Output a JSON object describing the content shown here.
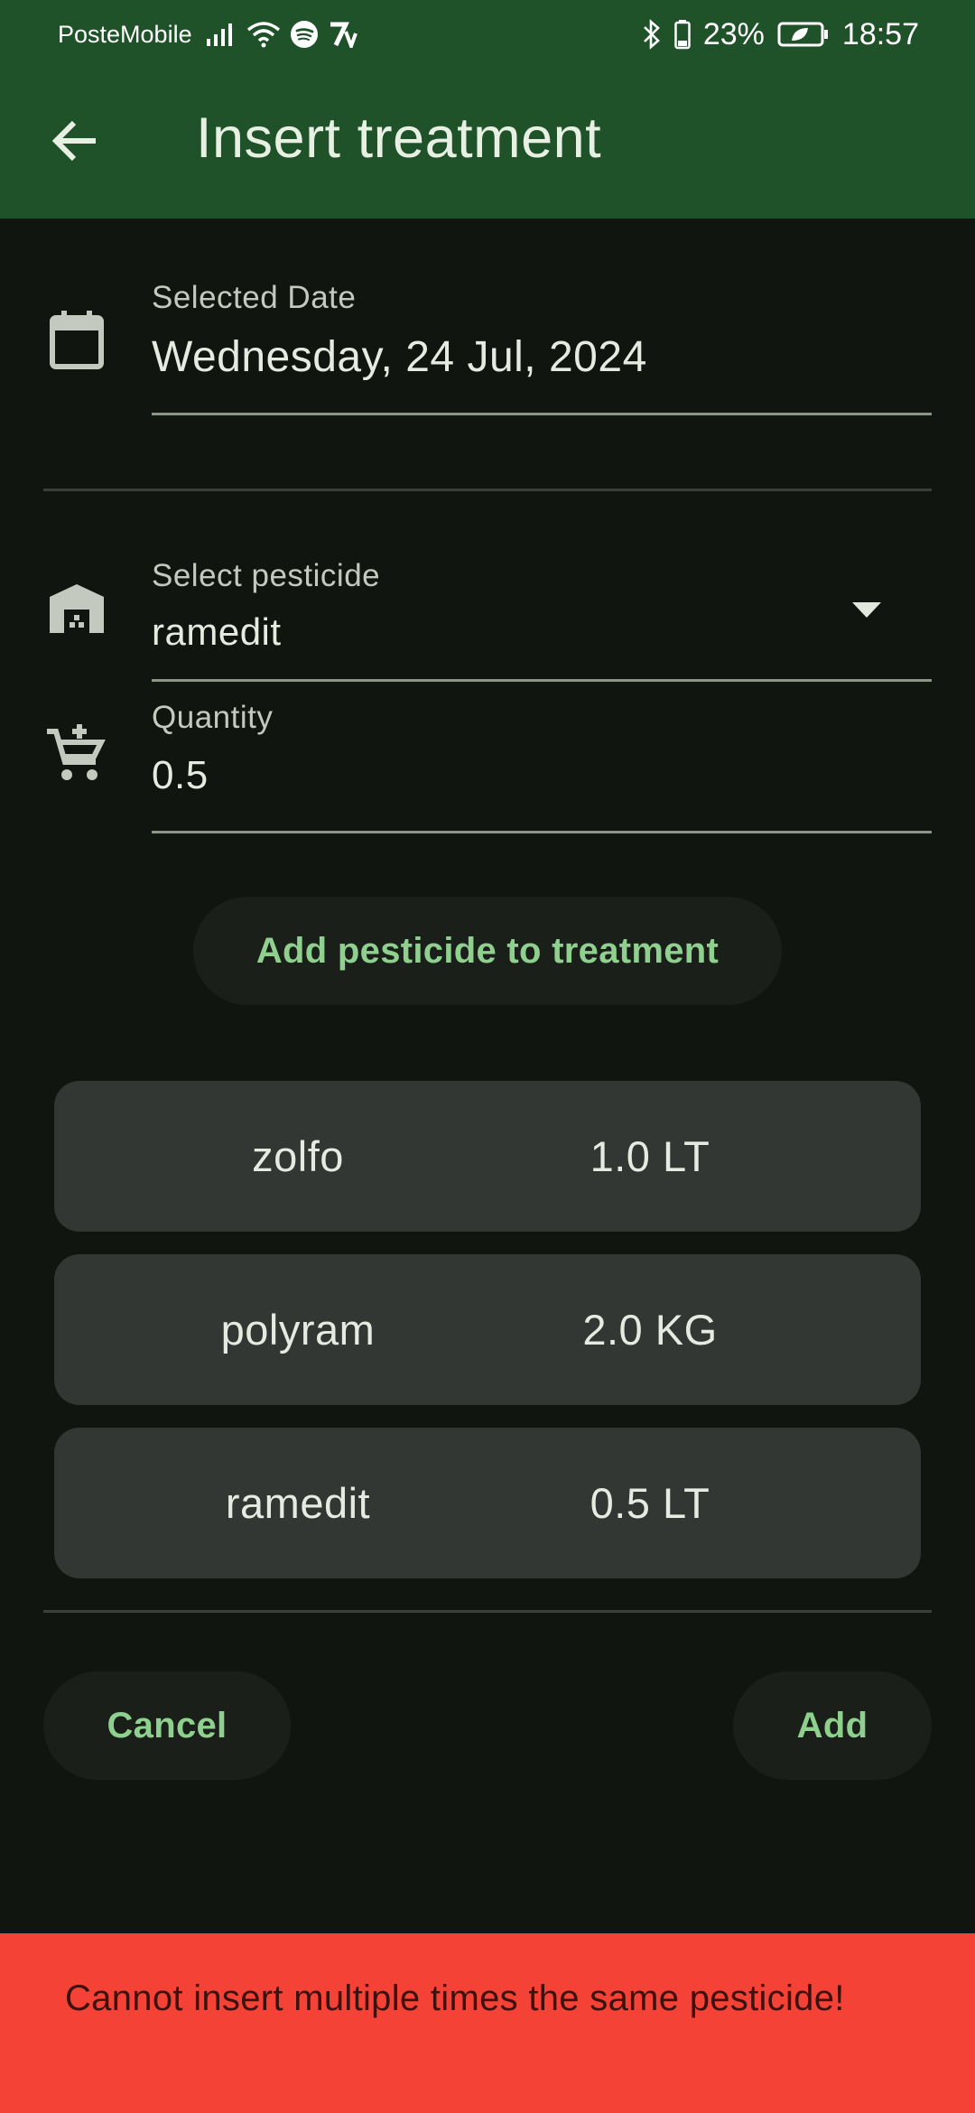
{
  "status_bar": {
    "carrier": "PosteMobile",
    "battery": "23%",
    "time": "18:57",
    "icons": [
      "signal-icon",
      "wifi-icon",
      "spotify-icon",
      "app-notification-icon",
      "bluetooth-icon",
      "battery-icon",
      "battery-saver-icon"
    ]
  },
  "app_bar": {
    "title": "Insert treatment",
    "back_icon": "arrow-back-icon",
    "color": "#20522a"
  },
  "date_field": {
    "label": "Selected Date",
    "value": "Wednesday, 24 Jul, 2024",
    "icon": "calendar-icon"
  },
  "pesticide_field": {
    "label": "Select pesticide",
    "value": "ramedit",
    "icon": "warehouse-icon"
  },
  "quantity_field": {
    "label": "Quantity",
    "value": "0.5",
    "icon": "add-shopping-cart-icon"
  },
  "add_pesticide_button": {
    "label": "Add pesticide to treatment"
  },
  "pesticides": [
    {
      "name": "zolfo",
      "quantity": "1.0 LT"
    },
    {
      "name": "polyram",
      "quantity": "2.0 KG"
    },
    {
      "name": "ramedit",
      "quantity": "0.5 LT"
    }
  ],
  "actions": {
    "cancel_label": "Cancel",
    "add_label": "Add"
  },
  "snackbar": {
    "message": "Cannot insert multiple times the same pesticide!",
    "color": "#f44336"
  },
  "accent_color": "#8fd08f"
}
